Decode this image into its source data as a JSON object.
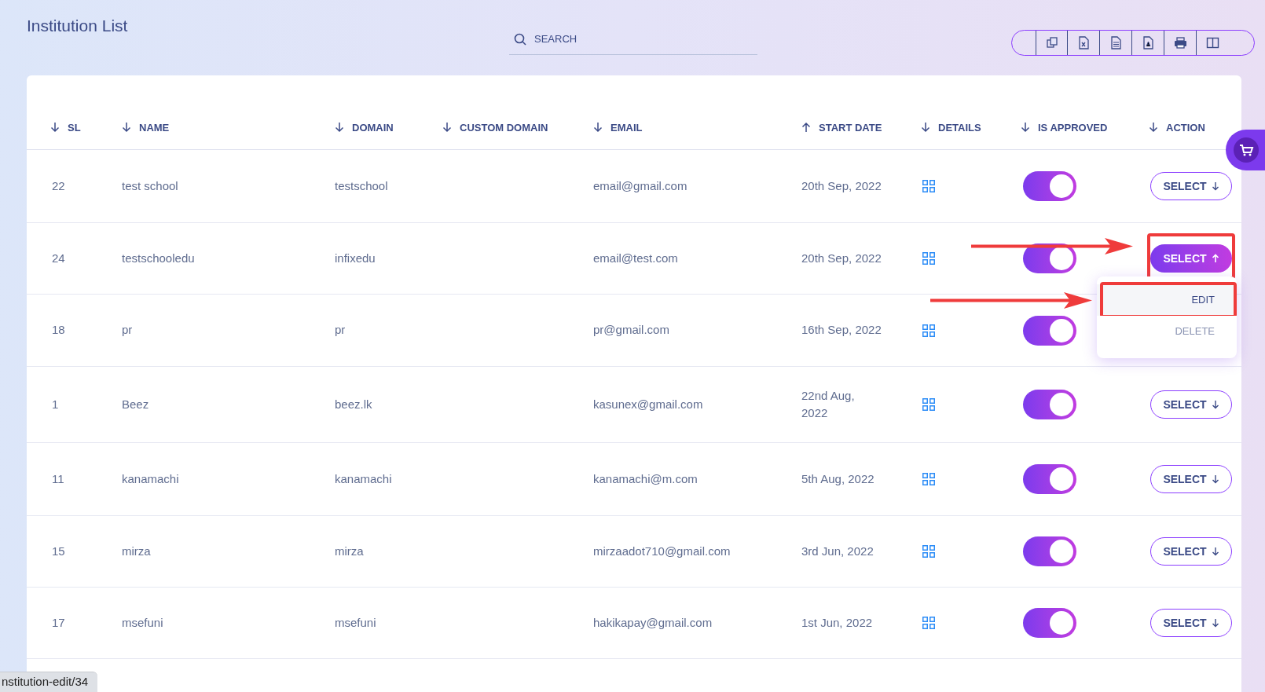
{
  "page_title": "Institution List",
  "search": {
    "placeholder": "SEARCH"
  },
  "toolbar": [
    {
      "kind": "copy"
    },
    {
      "kind": "excel"
    },
    {
      "kind": "csv"
    },
    {
      "kind": "pdf"
    },
    {
      "kind": "print"
    },
    {
      "kind": "columns"
    }
  ],
  "table": {
    "columns": [
      {
        "label": "SL",
        "ascending": false
      },
      {
        "label": "NAME",
        "ascending": false
      },
      {
        "label": "DOMAIN",
        "ascending": false
      },
      {
        "label": "CUSTOM DOMAIN",
        "ascending": false
      },
      {
        "label": "EMAIL",
        "ascending": false
      },
      {
        "label": "START DATE",
        "ascending": true
      },
      {
        "label": "DETAILS",
        "ascending": false
      },
      {
        "label": "IS APPROVED",
        "ascending": false
      },
      {
        "label": "ACTION",
        "ascending": false
      }
    ],
    "rows": [
      {
        "sl": "22",
        "name": "test school",
        "domain": "testschool",
        "email": "email@gmail.com",
        "start_date": "20th Sep, 2022",
        "approved": true,
        "action": {
          "label": "SELECT",
          "open": false
        }
      },
      {
        "sl": "24",
        "name": "testschooledu",
        "domain": "infixedu",
        "email": "email@test.com",
        "start_date": "20th Sep, 2022",
        "approved": true,
        "action": {
          "label": "SELECT",
          "open": true,
          "highlight": true,
          "menu": [
            {
              "label": "EDIT",
              "hovered": true,
              "highlight": true
            },
            {
              "label": "DELETE",
              "hovered": false
            }
          ]
        }
      },
      {
        "sl": "18",
        "name": "pr",
        "domain": "pr",
        "email": "pr@gmail.com",
        "start_date": "16th Sep, 2022",
        "approved": true
      },
      {
        "sl": "1",
        "name": "Beez",
        "domain": "beez.lk",
        "email": "kasunex@gmail.com",
        "start_date": "22nd Aug, 2022",
        "approved": true,
        "action": {
          "label": "SELECT",
          "open": false
        }
      },
      {
        "sl": "11",
        "name": "kanamachi",
        "domain": "kanamachi",
        "email": "kanamachi@m.com",
        "start_date": "5th Aug, 2022",
        "approved": true,
        "action": {
          "label": "SELECT",
          "open": false
        }
      },
      {
        "sl": "15",
        "name": "mirza",
        "domain": "mirza",
        "email": "mirzaadot710@gmail.com",
        "start_date": "3rd Jun, 2022",
        "approved": true,
        "action": {
          "label": "SELECT",
          "open": false
        }
      },
      {
        "sl": "17",
        "name": "msefuni",
        "domain": "msefuni",
        "email": "hakikapay@gmail.com",
        "start_date": "1st Jun, 2022",
        "approved": true,
        "action": {
          "label": "SELECT",
          "open": false
        }
      }
    ]
  },
  "status_bar": {
    "url": "nstitution-edit/34"
  }
}
